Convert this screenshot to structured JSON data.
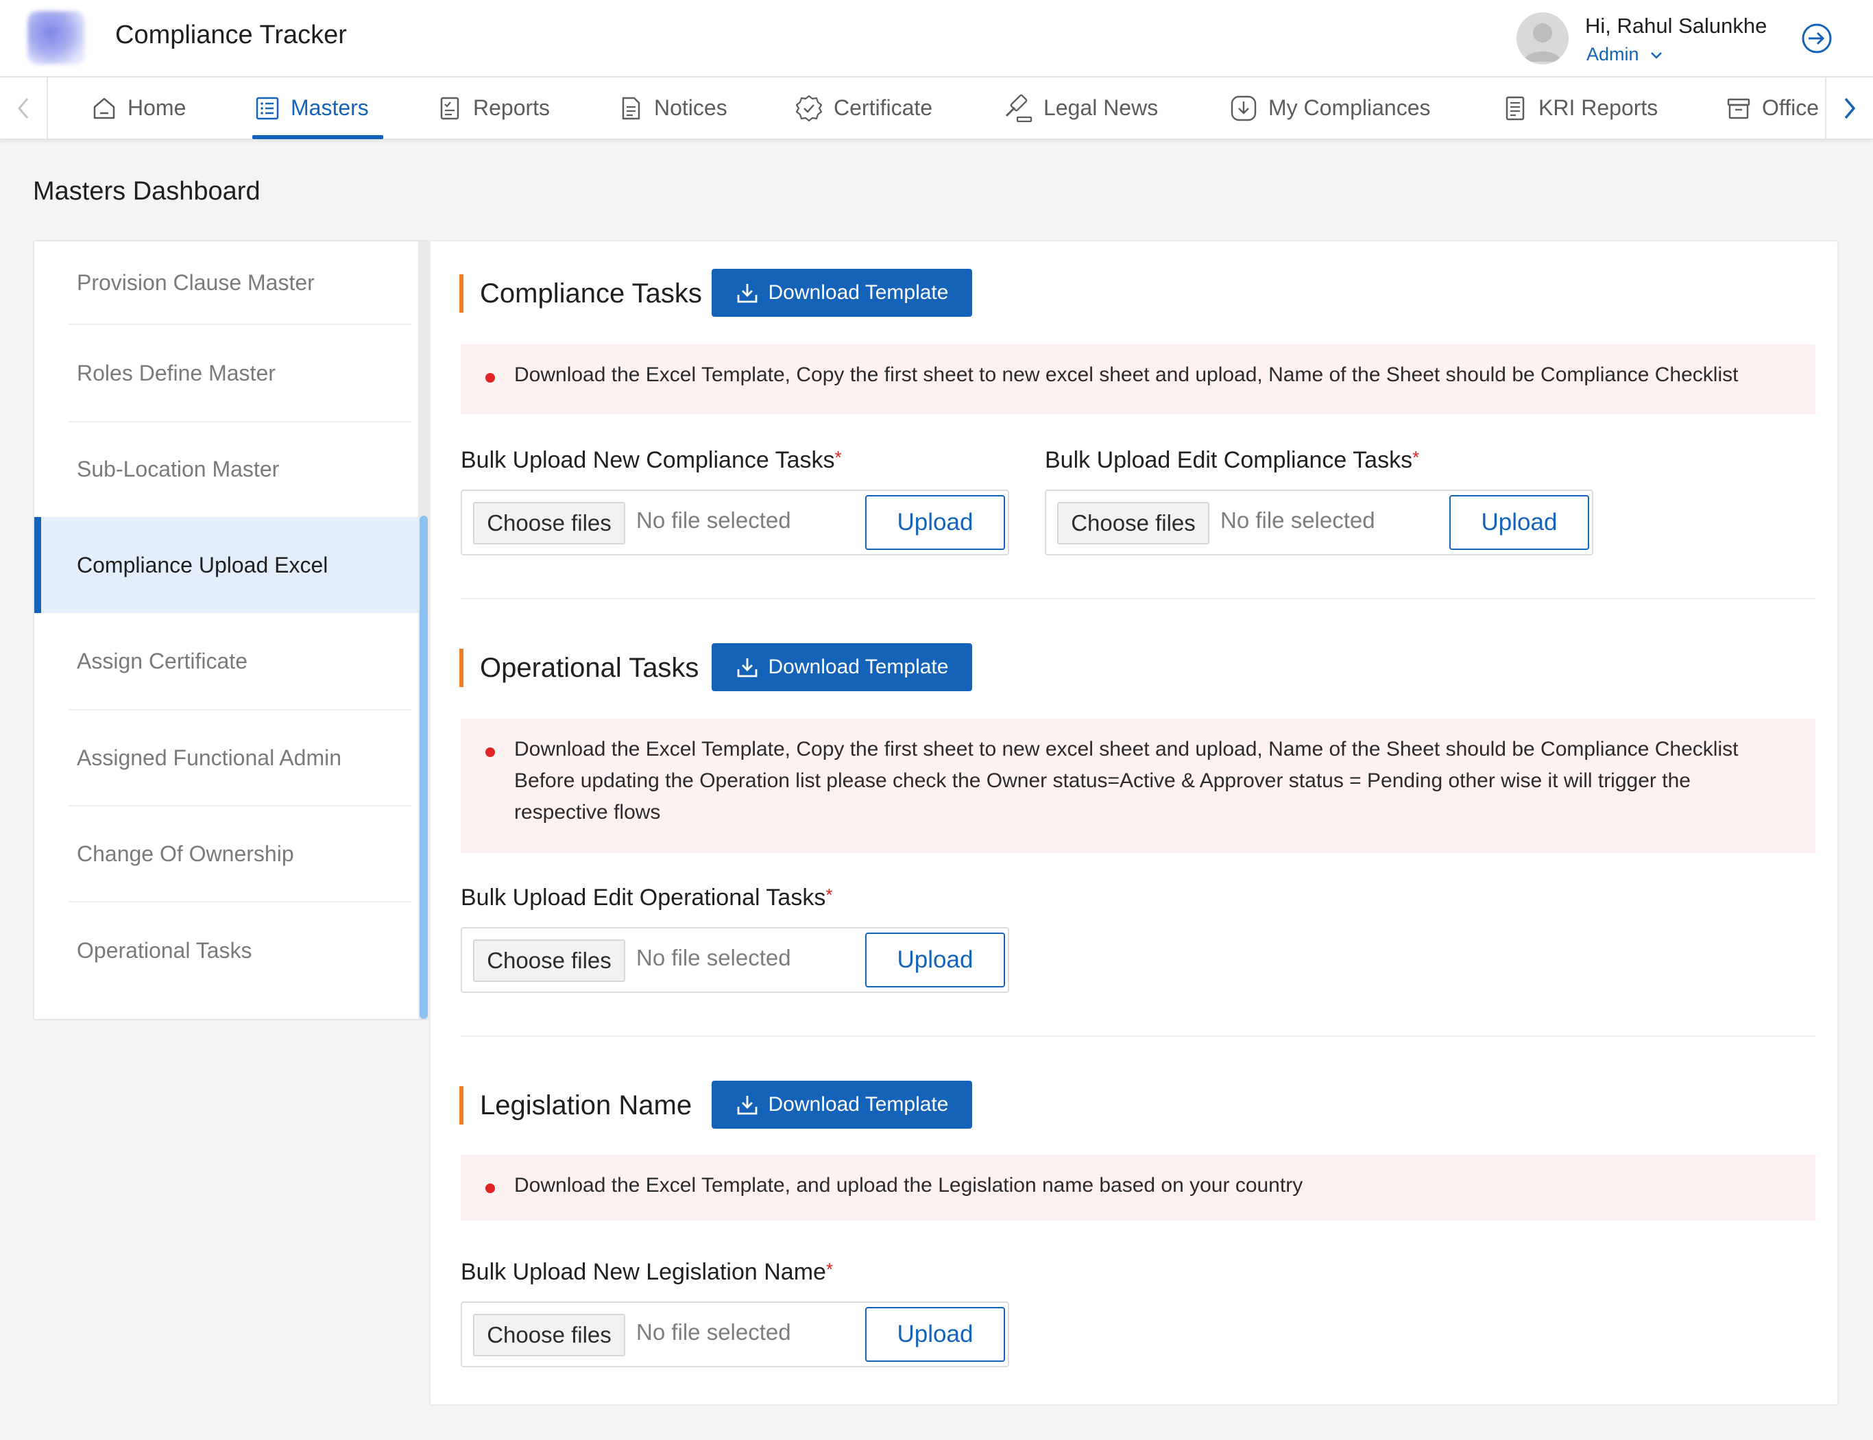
{
  "header": {
    "app_title": "Compliance Tracker",
    "user_greeting": "Hi, Rahul Salunkhe",
    "user_role": "Admin"
  },
  "nav": {
    "items": [
      {
        "label": "Home",
        "icon": "home-icon"
      },
      {
        "label": "Masters",
        "icon": "list-icon",
        "active": true
      },
      {
        "label": "Reports",
        "icon": "report-icon"
      },
      {
        "label": "Notices",
        "icon": "document-icon"
      },
      {
        "label": "Certificate",
        "icon": "badge-icon"
      },
      {
        "label": "Legal News",
        "icon": "gavel-icon"
      },
      {
        "label": "My Compliances",
        "icon": "download-circle-icon"
      },
      {
        "label": "KRI Reports",
        "icon": "report-list-icon"
      },
      {
        "label": "Office",
        "icon": "archive-icon"
      }
    ]
  },
  "page": {
    "title": "Masters Dashboard"
  },
  "sidebar": {
    "items": [
      {
        "label": "Provision Clause Master"
      },
      {
        "label": "Roles Define Master"
      },
      {
        "label": "Sub-Location Master"
      },
      {
        "label": "Compliance Upload Excel",
        "active": true
      },
      {
        "label": "Assign Certificate"
      },
      {
        "label": "Assigned Functional Admin"
      },
      {
        "label": "Change Of Ownership"
      },
      {
        "label": "Operational Tasks"
      }
    ]
  },
  "common": {
    "download_template": "Download Template",
    "choose_files": "Choose files",
    "no_file": "No file selected",
    "upload": "Upload",
    "required_mark": "*"
  },
  "sections": [
    {
      "title": "Compliance Tasks",
      "notice": "Download the Excel Template, Copy the first sheet to new excel sheet and upload, Name of the Sheet should be Compliance Checklist",
      "fields": [
        {
          "label": "Bulk Upload New Compliance Tasks"
        },
        {
          "label": "Bulk Upload Edit Compliance Tasks"
        }
      ]
    },
    {
      "title": "Operational Tasks",
      "notice": "Download the Excel Template, Copy the first sheet to new excel sheet and upload, Name of the Sheet should be Compliance Checklist Before updating the Operation list please check the Owner status=Active & Approver status = Pending other wise it will trigger the respective flows",
      "fields": [
        {
          "label": "Bulk Upload Edit Operational Tasks"
        }
      ]
    },
    {
      "title": "Legislation Name",
      "notice": "Download the Excel Template, and upload the Legislation name based on your country",
      "fields": [
        {
          "label": "Bulk Upload New Legislation Name"
        }
      ]
    }
  ],
  "colors": {
    "primary": "#1463b8",
    "accent_orange": "#f07f22",
    "notice_bg": "#fdf1f1",
    "required_red": "#e02424",
    "active_sidebar_bg": "#e3eefb"
  }
}
